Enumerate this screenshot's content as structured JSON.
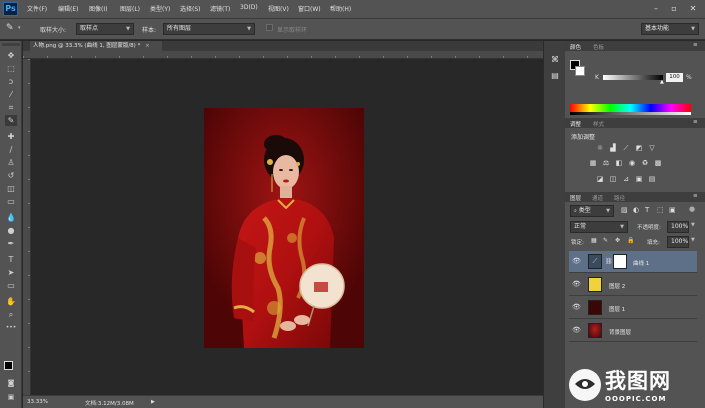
{
  "app": {
    "logo": "Ps"
  },
  "menu": [
    "文件(F)",
    "编辑(E)",
    "图像(I)",
    "图层(L)",
    "类型(Y)",
    "选择(S)",
    "滤镜(T)",
    "3D(D)",
    "视图(V)",
    "窗口(W)",
    "帮助(H)"
  ],
  "options": {
    "sample_size_label": "取样大小:",
    "sample_size_value": "取样点",
    "sample_label": "样本:",
    "sample_value": "所有图层",
    "show_ring_label": "显示取样环",
    "workspace": "基本功能"
  },
  "document": {
    "tab_title": "人物.png @ 33.3% (曲线 1, 图层蒙版/8) *",
    "zoom": "33.33%",
    "doc_size": "文档:3.12M/3.08M"
  },
  "color_panel": {
    "tabs": [
      "颜色",
      "色板"
    ],
    "k_label": "K",
    "k_value": "100",
    "percent": "%"
  },
  "adjustments_panel": {
    "tabs": [
      "调整",
      "样式"
    ],
    "heading": "添加调整"
  },
  "layers_panel": {
    "tabs": [
      "图层",
      "通道",
      "路径"
    ],
    "kind_filter": "类型",
    "blend_mode": "正常",
    "opacity_label": "不透明度:",
    "opacity_value": "100%",
    "lock_label": "锁定:",
    "fill_label": "填充:",
    "fill_value": "100%",
    "layers": [
      {
        "name": "曲线 1",
        "selected": true
      },
      {
        "name": "图层 2",
        "selected": false
      },
      {
        "name": "图层 1",
        "selected": false
      },
      {
        "name": "背景图层",
        "selected": false
      }
    ]
  },
  "watermark": {
    "title": "我图网",
    "url": "OOOPIC.COM"
  },
  "colors": {
    "photo_bg": "#7a0909",
    "layer2_fill": "#f2d23a",
    "selected_layer": "#5e7088"
  }
}
